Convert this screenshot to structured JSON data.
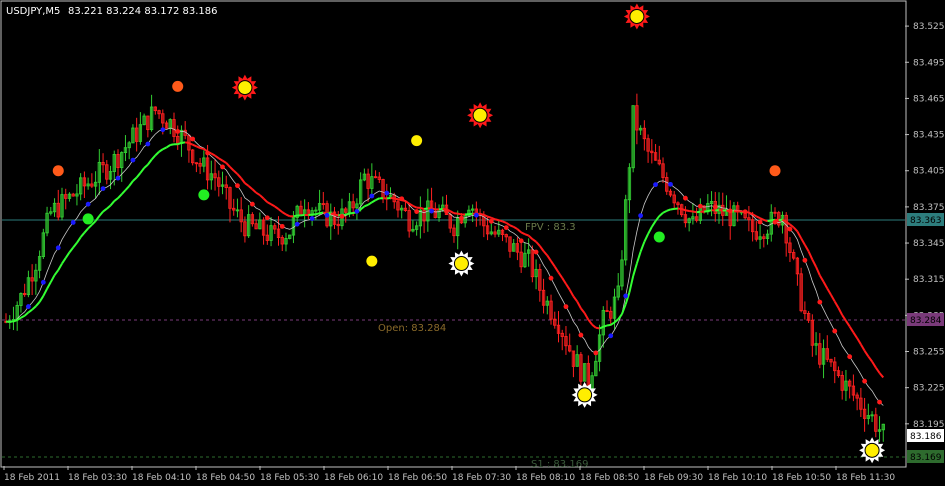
{
  "header": {
    "symbol": "USDJPY,M5",
    "ohlc": "83.221 83.224 83.172 83.186"
  },
  "colors": {
    "background": "#000000",
    "axis": "#c0c0c0",
    "bull_candle": "#32cd32",
    "bear_candle": "#ff2020",
    "ma_green": "#33ff33",
    "ma_red": "#ff1a1a",
    "ma_thin": "#c8c8c8",
    "dot_blue": "#1a1aff",
    "dot_red": "#ff1a1a",
    "open_line": "#7a3a7a",
    "fpv_line": "#2d7d7d",
    "s1_line": "#2e6b2e",
    "marker_yellow": "#ffee00",
    "marker_orange": "#ff5a1a",
    "marker_green": "#22ee22"
  },
  "labels": {
    "open": "Open: 83.284",
    "fpv": "FPV : 83.3",
    "s1": "S1 : 83.169"
  },
  "badges": {
    "fpv": "83.363",
    "open": "83.284",
    "last": "83.186",
    "s1": "83.169"
  },
  "chart_data": {
    "type": "candlestick",
    "y_axis_side": "right",
    "ylim": [
      83.16,
      83.545
    ],
    "y_ticks": [
      83.525,
      83.495,
      83.465,
      83.435,
      83.405,
      83.375,
      83.345,
      83.315,
      83.285,
      83.255,
      83.225,
      83.195
    ],
    "x_ticks": [
      "18 Feb 2011",
      "18 Feb 03:30",
      "18 Feb 04:10",
      "18 Feb 04:50",
      "18 Feb 05:30",
      "18 Feb 06:10",
      "18 Feb 06:50",
      "18 Feb 07:30",
      "18 Feb 08:10",
      "18 Feb 08:50",
      "18 Feb 09:30",
      "18 Feb 10:10",
      "18 Feb 10:50",
      "18 Feb 11:30"
    ],
    "levels": [
      {
        "name": "Open",
        "value": 83.284
      },
      {
        "name": "FPV",
        "value": 83.363
      },
      {
        "name": "S1",
        "value": 83.169
      }
    ],
    "close_series": [
      [
        0,
        83.28
      ],
      [
        4,
        83.3
      ],
      [
        8,
        83.33
      ],
      [
        12,
        83.37
      ],
      [
        16,
        83.38
      ],
      [
        20,
        83.39
      ],
      [
        24,
        83.4
      ],
      [
        28,
        83.41
      ],
      [
        32,
        83.425
      ],
      [
        36,
        83.44
      ],
      [
        40,
        83.455
      ],
      [
        44,
        83.445
      ],
      [
        48,
        83.43
      ],
      [
        52,
        83.41
      ],
      [
        56,
        83.4
      ],
      [
        60,
        83.375
      ],
      [
        64,
        83.36
      ],
      [
        68,
        83.355
      ],
      [
        72,
        83.35
      ],
      [
        76,
        83.355
      ],
      [
        80,
        83.38
      ],
      [
        84,
        83.37
      ],
      [
        88,
        83.365
      ],
      [
        92,
        83.37
      ],
      [
        96,
        83.4
      ],
      [
        100,
        83.39
      ],
      [
        104,
        83.38
      ],
      [
        108,
        83.365
      ],
      [
        112,
        83.37
      ],
      [
        116,
        83.37
      ],
      [
        120,
        83.36
      ],
      [
        124,
        83.38
      ],
      [
        128,
        83.36
      ],
      [
        132,
        83.35
      ],
      [
        136,
        83.34
      ],
      [
        140,
        83.33
      ],
      [
        144,
        83.3
      ],
      [
        148,
        83.28
      ],
      [
        152,
        83.25
      ],
      [
        156,
        83.23
      ],
      [
        160,
        83.28
      ],
      [
        164,
        83.3
      ],
      [
        168,
        83.45
      ],
      [
        172,
        83.42
      ],
      [
        176,
        83.4
      ],
      [
        180,
        83.38
      ],
      [
        184,
        83.36
      ],
      [
        188,
        83.375
      ],
      [
        192,
        83.37
      ],
      [
        196,
        83.365
      ],
      [
        200,
        83.355
      ],
      [
        204,
        83.36
      ],
      [
        208,
        83.37
      ],
      [
        212,
        83.31
      ],
      [
        216,
        83.26
      ],
      [
        220,
        83.245
      ],
      [
        224,
        83.23
      ],
      [
        228,
        83.215
      ],
      [
        232,
        83.2
      ],
      [
        235,
        83.186
      ]
    ],
    "swing_highs": [
      {
        "x": 64,
        "y": 83.474
      },
      {
        "x": 127,
        "y": 83.451
      },
      {
        "x": 169,
        "y": 83.533
      }
    ],
    "swing_lows": [
      {
        "x": 122,
        "y": 83.328
      },
      {
        "x": 155,
        "y": 83.219
      },
      {
        "x": 232,
        "y": 83.173
      }
    ]
  }
}
